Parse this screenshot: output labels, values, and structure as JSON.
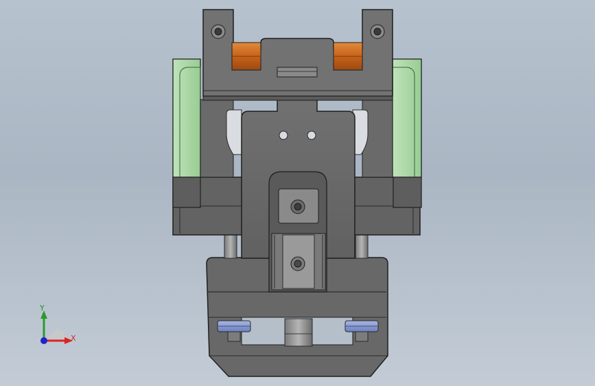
{
  "viewport": {
    "background": "#b6c2ce",
    "model": {
      "description_parts": [
        "top-clamp",
        "hinge-rollers",
        "side-guides",
        "center-plate",
        "slide-block",
        "base-block",
        "pneumatic-cylinders"
      ],
      "colors": {
        "steel": "#6b6b6b",
        "steel_dark": "#4e4e4e",
        "steel_light": "#8a8a8a",
        "roller": "#d06a1c",
        "guide": "#a5d6a0",
        "cylinder": "#8ea0d6"
      }
    }
  },
  "triad": {
    "x_label": "X",
    "y_label": "Y",
    "x_color": "#dd2222",
    "y_color": "#2a9a2a",
    "z_color": "#2222cc"
  }
}
